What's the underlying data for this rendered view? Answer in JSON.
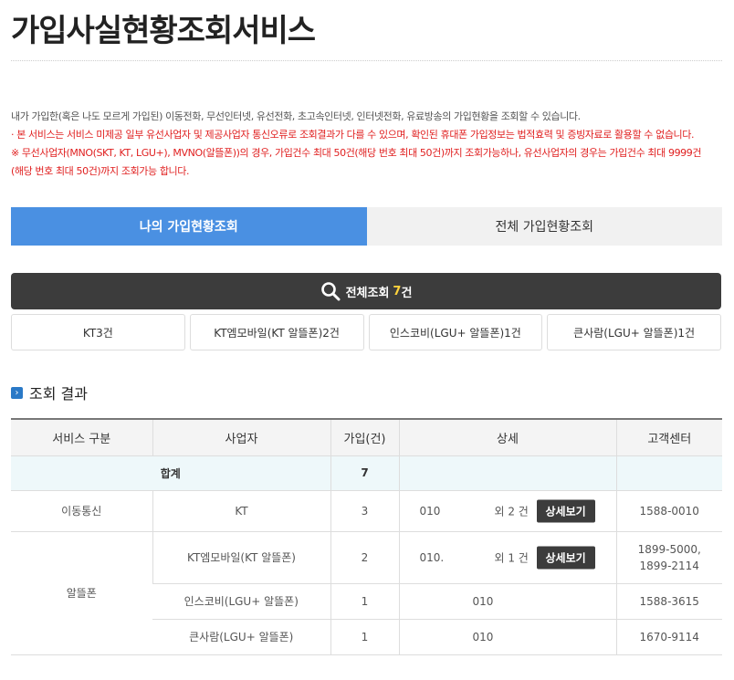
{
  "page": {
    "title": "가입사실현황조회서비스"
  },
  "notice": {
    "lines": [
      "내가 가입한(혹은 나도 모르게 가입된) 이동전화, 무선인터넷, 유선전화, 초고속인터넷, 인터넷전화, 유료방송의 가입현황을 조회할 수 있습니다.",
      "· 본 서비스는 서비스 미제공 일부 유선사업자 및 제공사업자 통신오류로 조회결과가 다를 수 있으며, 확인된 휴대폰 가입정보는 법적효력 및 증빙자료로 활용할 수 없습니다.",
      "※ 무선사업자(MNO(SKT, KT, LGU+), MVNO(알뜰폰))의 경우, 가입건수 최대 50건(해당 번호 최대 50건)까지 조회가능하나, 유선사업자의 경우는 가입건수 최대 9999건",
      "(해당 번호 최대 50건)까지 조회가능 합니다."
    ]
  },
  "tabs": [
    {
      "label": "나의 가입현황조회",
      "active": true
    },
    {
      "label": "전체 가입현황조회",
      "active": false
    }
  ],
  "total": {
    "label": "전체조회",
    "count": "7",
    "unit": "건"
  },
  "carriers": [
    "KT3건",
    "KT엠모바일(KT 알뜰폰)2건",
    "인스코비(LGU+ 알뜰폰)1건",
    "큰사람(LGU+ 알뜰폰)1건"
  ],
  "section": {
    "icon": "chevron-right-icon",
    "title": "조회 결과"
  },
  "table": {
    "headers": [
      "서비스 구분",
      "사업자",
      "가입(건)",
      "상세",
      "고객센터"
    ],
    "sum": {
      "label": "합계",
      "count": "7"
    },
    "rows": [
      {
        "category": "이동통신",
        "provider": "KT",
        "count": "3",
        "number": "010",
        "extra": "외 2 건",
        "button": "상세보기",
        "phone": "1588-0010"
      },
      {
        "category": "알뜰폰",
        "provider": "KT엠모바일(KT 알뜰폰)",
        "count": "2",
        "number": "010.",
        "extra": "외 1 건",
        "button": "상세보기",
        "phone": "1899-5000,",
        "phone2": "1899-2114"
      },
      {
        "provider": "인스코비(LGU+ 알뜰폰)",
        "count": "1",
        "number": "010",
        "phone": "1588-3615"
      },
      {
        "provider": "큰사람(LGU+ 알뜰폰)",
        "count": "1",
        "number": "010",
        "phone": "1670-9114"
      }
    ]
  },
  "colors": {
    "accent": "#4a90e2",
    "dark": "#3c3c3c",
    "highlight": "#ffd23c",
    "warning": "#e02020"
  }
}
